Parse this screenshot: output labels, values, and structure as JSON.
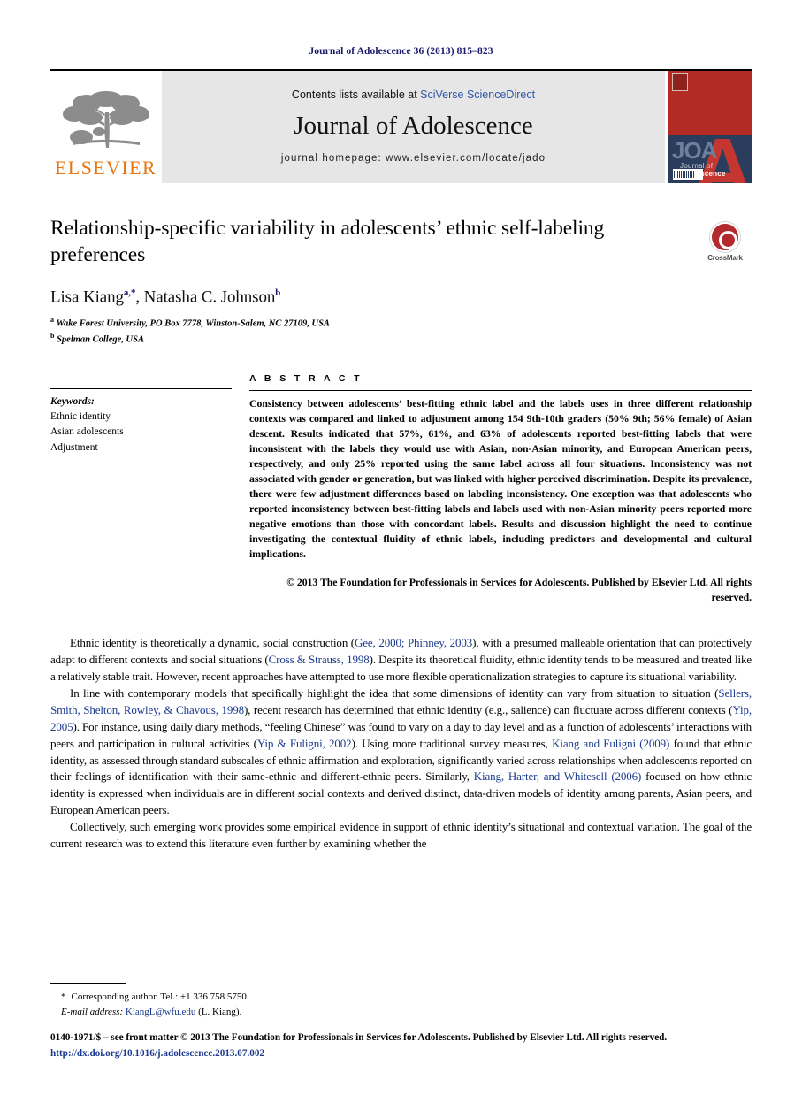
{
  "running_head": "Journal of Adolescence 36 (2013) 815–823",
  "masthead": {
    "publisher_name": "ELSEVIER",
    "contents_prefix": "Contents lists available at ",
    "contents_link": "SciVerse ScienceDirect",
    "journal_title": "Journal of Adolescence",
    "homepage": "journal homepage: www.elsevier.com/locate/jado",
    "cover": {
      "acronym": "JOA",
      "name_prefix": "Journal of ",
      "name_bold": "Adolescence"
    }
  },
  "article": {
    "title": "Relationship-specific variability in adolescents’ ethnic self-labeling preferences",
    "authors": "Lisa Kiang",
    "author_sup_1": "a,*",
    "authors_2": ", Natasha C. Johnson",
    "author_sup_2": "b",
    "affiliation_a_sup": "a",
    "affiliation_a": "Wake Forest University, PO Box 7778, Winston-Salem, NC 27109, USA",
    "affiliation_b_sup": "b",
    "affiliation_b": "Spelman College, USA",
    "crossmark_label": "CrossMark"
  },
  "keywords": {
    "heading": "Keywords:",
    "items": [
      "Ethnic identity",
      "Asian adolescents",
      "Adjustment"
    ]
  },
  "abstract": {
    "heading": "A B S T R A C T",
    "text": "Consistency between adolescents’ best-fitting ethnic label and the labels uses in three different relationship contexts was compared and linked to adjustment among 154 9th-10th graders (50% 9th; 56% female) of Asian descent. Results indicated that 57%, 61%, and 63% of adolescents reported best-fitting labels that were inconsistent with the labels they would use with Asian, non-Asian minority, and European American peers, respectively, and only 25% reported using the same label across all four situations. Inconsistency was not associated with gender or generation, but was linked with higher perceived discrimination. Despite its prevalence, there were few adjustment differences based on labeling inconsistency. One exception was that adolescents who reported inconsistency between best-fitting labels and labels used with non-Asian minority peers reported more negative emotions than those with concordant labels. Results and discussion highlight the need to continue investigating the contextual fluidity of ethnic labels, including predictors and developmental and cultural implications.",
    "copyright": "© 2013 The Foundation for Professionals in Services for Adolescents. Published by Elsevier Ltd. All rights reserved."
  },
  "body": {
    "paragraphs": [
      {
        "segments": [
          {
            "t": "Ethnic identity is theoretically a dynamic, social construction (",
            "k": "text"
          },
          {
            "t": "Gee, 2000; Phinney, 2003",
            "k": "cite"
          },
          {
            "t": "), with a presumed malleable orientation that can protectively adapt to different contexts and social situations (",
            "k": "text"
          },
          {
            "t": "Cross & Strauss, 1998",
            "k": "cite"
          },
          {
            "t": "). Despite its theoretical fluidity, ethnic identity tends to be measured and treated like a relatively stable trait. However, recent approaches have attempted to use more flexible operationalization strategies to capture its situational variability.",
            "k": "text"
          }
        ]
      },
      {
        "segments": [
          {
            "t": "In line with contemporary models that specifically highlight the idea that some dimensions of identity can vary from situation to situation (",
            "k": "text"
          },
          {
            "t": "Sellers, Smith, Shelton, Rowley, & Chavous, 1998",
            "k": "cite"
          },
          {
            "t": "), recent research has determined that ethnic identity (e.g., salience) can fluctuate across different contexts (",
            "k": "text"
          },
          {
            "t": "Yip, 2005",
            "k": "cite"
          },
          {
            "t": "). For instance, using daily diary methods, “feeling Chinese” was found to vary on a day to day level and as a function of adolescents’ interactions with peers and participation in cultural activities (",
            "k": "text"
          },
          {
            "t": "Yip & Fuligni, 2002",
            "k": "cite"
          },
          {
            "t": "). Using more traditional survey measures, ",
            "k": "text"
          },
          {
            "t": "Kiang and Fuligni (2009)",
            "k": "cite"
          },
          {
            "t": " found that ethnic identity, as assessed through standard subscales of ethnic affirmation and exploration, significantly varied across relationships when adolescents reported on their feelings of identification with their same-ethnic and different-ethnic peers. Similarly, ",
            "k": "text"
          },
          {
            "t": "Kiang, Harter, and Whitesell (2006)",
            "k": "cite"
          },
          {
            "t": " focused on how ethnic identity is expressed when individuals are in different social contexts and derived distinct, data-driven models of identity among parents, Asian peers, and European American peers.",
            "k": "text"
          }
        ]
      },
      {
        "segments": [
          {
            "t": "Collectively, such emerging work provides some empirical evidence in support of ethnic identity’s situational and contextual variation. The goal of the current research was to extend this literature even further by examining whether the",
            "k": "text"
          }
        ]
      }
    ]
  },
  "footnotes": {
    "corresponding_star": "*",
    "corresponding": "Corresponding author. Tel.: +1 336 758 5750.",
    "email_label": "E-mail address:",
    "email": "KiangL@wfu.edu",
    "email_suffix": " (L. Kiang)."
  },
  "bottom": {
    "issn_line": "0140-1971/$ – see front matter © 2013 The Foundation for Professionals in Services for Adolescents. Published by Elsevier Ltd. All rights reserved.",
    "doi": "http://dx.doi.org/10.1016/j.adolescence.2013.07.002"
  },
  "colors": {
    "link_blue": "#1a3a8f",
    "elsevier_orange": "#E87511",
    "crossmark_red": "#b2292e",
    "cover_red": "#b42a24",
    "cover_navy": "#2b3d5c"
  }
}
